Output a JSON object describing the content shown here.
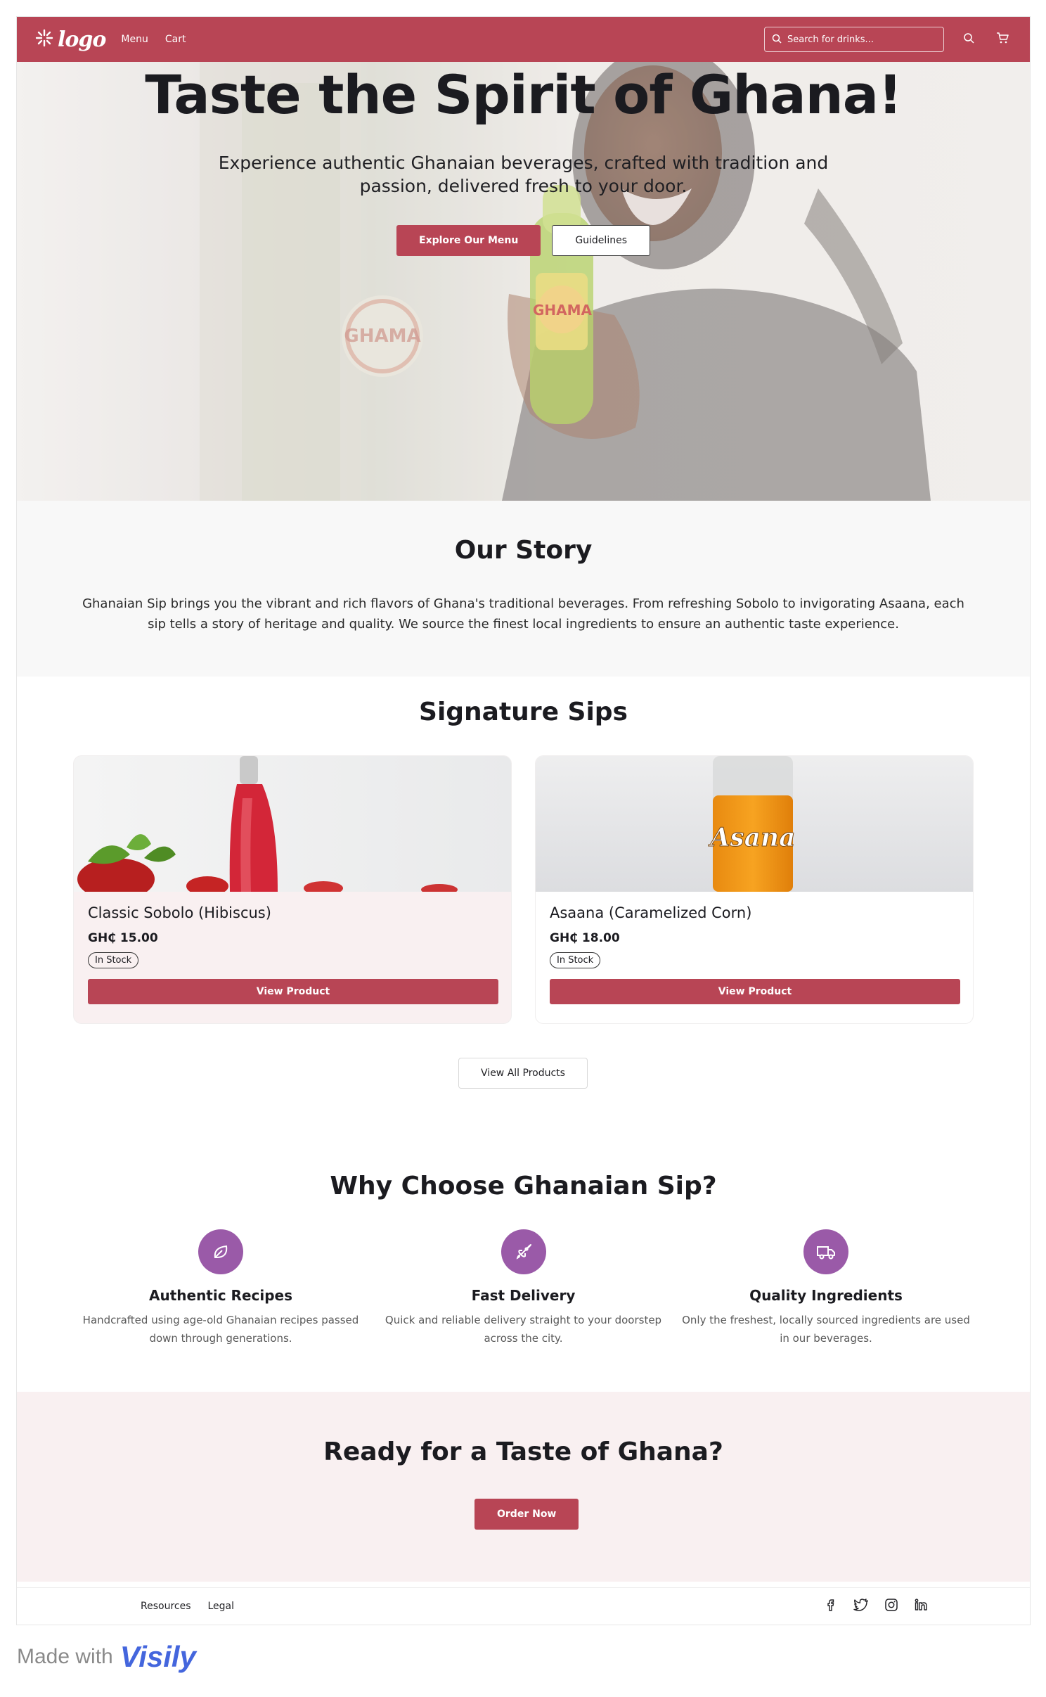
{
  "nav": {
    "logo_text": "logo",
    "links": [
      "Menu",
      "Cart"
    ],
    "search_placeholder": "Search for drinks..."
  },
  "hero": {
    "title": "Taste the Spirit of Ghana!",
    "subtitle": "Experience authentic Ghanaian beverages, crafted with tradition and passion, delivered fresh to your door.",
    "primary_button": "Explore Our Menu",
    "secondary_button": "Guidelines",
    "bottle_label": "GHAMA"
  },
  "story": {
    "title": "Our Story",
    "text": "Ghanaian Sip brings you the vibrant and rich flavors of Ghana's traditional beverages. From refreshing Sobolo to invigorating Asaana, each sip tells a story of heritage and quality. We source the finest local ingredients to ensure an authentic taste experience."
  },
  "signature": {
    "title": "Signature Sips",
    "products": [
      {
        "name": "Classic Sobolo (Hibiscus)",
        "price": "GH₵ 15.00",
        "stock": "In Stock",
        "button": "View Product"
      },
      {
        "name": "Asaana (Caramelized Corn)",
        "price": "GH₵ 18.00",
        "stock": "In Stock",
        "button": "View Product",
        "bottle_label": "Asana"
      }
    ],
    "view_all": "View All Products"
  },
  "why": {
    "title": "Why Choose Ghanaian Sip?",
    "features": [
      {
        "icon": "leaf-icon",
        "title": "Authentic Recipes",
        "desc": "Handcrafted using age-old Ghanaian recipes passed down through generations."
      },
      {
        "icon": "rocket-icon",
        "title": "Fast Delivery",
        "desc": "Quick and reliable delivery straight to your doorstep across the city."
      },
      {
        "icon": "truck-icon",
        "title": "Quality Ingredients",
        "desc": "Only the freshest, locally sourced ingredients are used in our beverages."
      }
    ]
  },
  "cta": {
    "title": "Ready for a Taste of Ghana?",
    "button": "Order Now"
  },
  "footer": {
    "links": [
      "Resources",
      "Legal"
    ],
    "socials": [
      "facebook-icon",
      "twitter-icon",
      "instagram-icon",
      "linkedin-icon"
    ]
  },
  "made_with": {
    "text": "Made with",
    "brand": "Visily"
  },
  "colors": {
    "brand": "#b84555",
    "accent_purple": "#9a5aa8",
    "pink_bg": "#f9f0f1"
  }
}
